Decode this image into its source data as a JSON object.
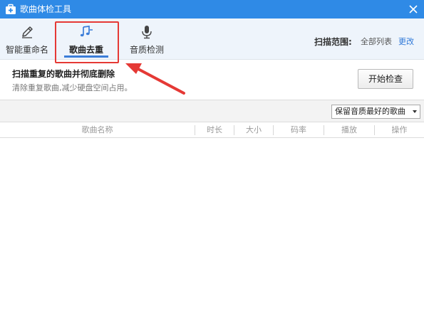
{
  "window": {
    "title": "歌曲体检工具",
    "app_icon": "toolbox-plus-icon",
    "close_icon": "close-icon"
  },
  "tabs": [
    {
      "label": "智能重命名",
      "icon": "pencil-icon"
    },
    {
      "label": "歌曲去重",
      "icon": "music-note-icon",
      "active": true
    },
    {
      "label": "音质检测",
      "icon": "microphone-icon"
    }
  ],
  "scan": {
    "label": "扫描范围:",
    "value": "全部列表",
    "change": "更改"
  },
  "description": {
    "title": "扫描重复的歌曲并彻底删除",
    "subtitle": "清除重复歌曲,减少硬盘空间占用。"
  },
  "actions": {
    "start_label": "开始检查"
  },
  "filter": {
    "selected": "保留音质最好的歌曲"
  },
  "table": {
    "columns": [
      "歌曲名称",
      "时长",
      "大小",
      "码率",
      "播放",
      "操作"
    ]
  },
  "colors": {
    "titlebar": "#2f8ae6",
    "accent": "#3b7dd8",
    "highlight": "#e53935",
    "link": "#2f78d8"
  }
}
